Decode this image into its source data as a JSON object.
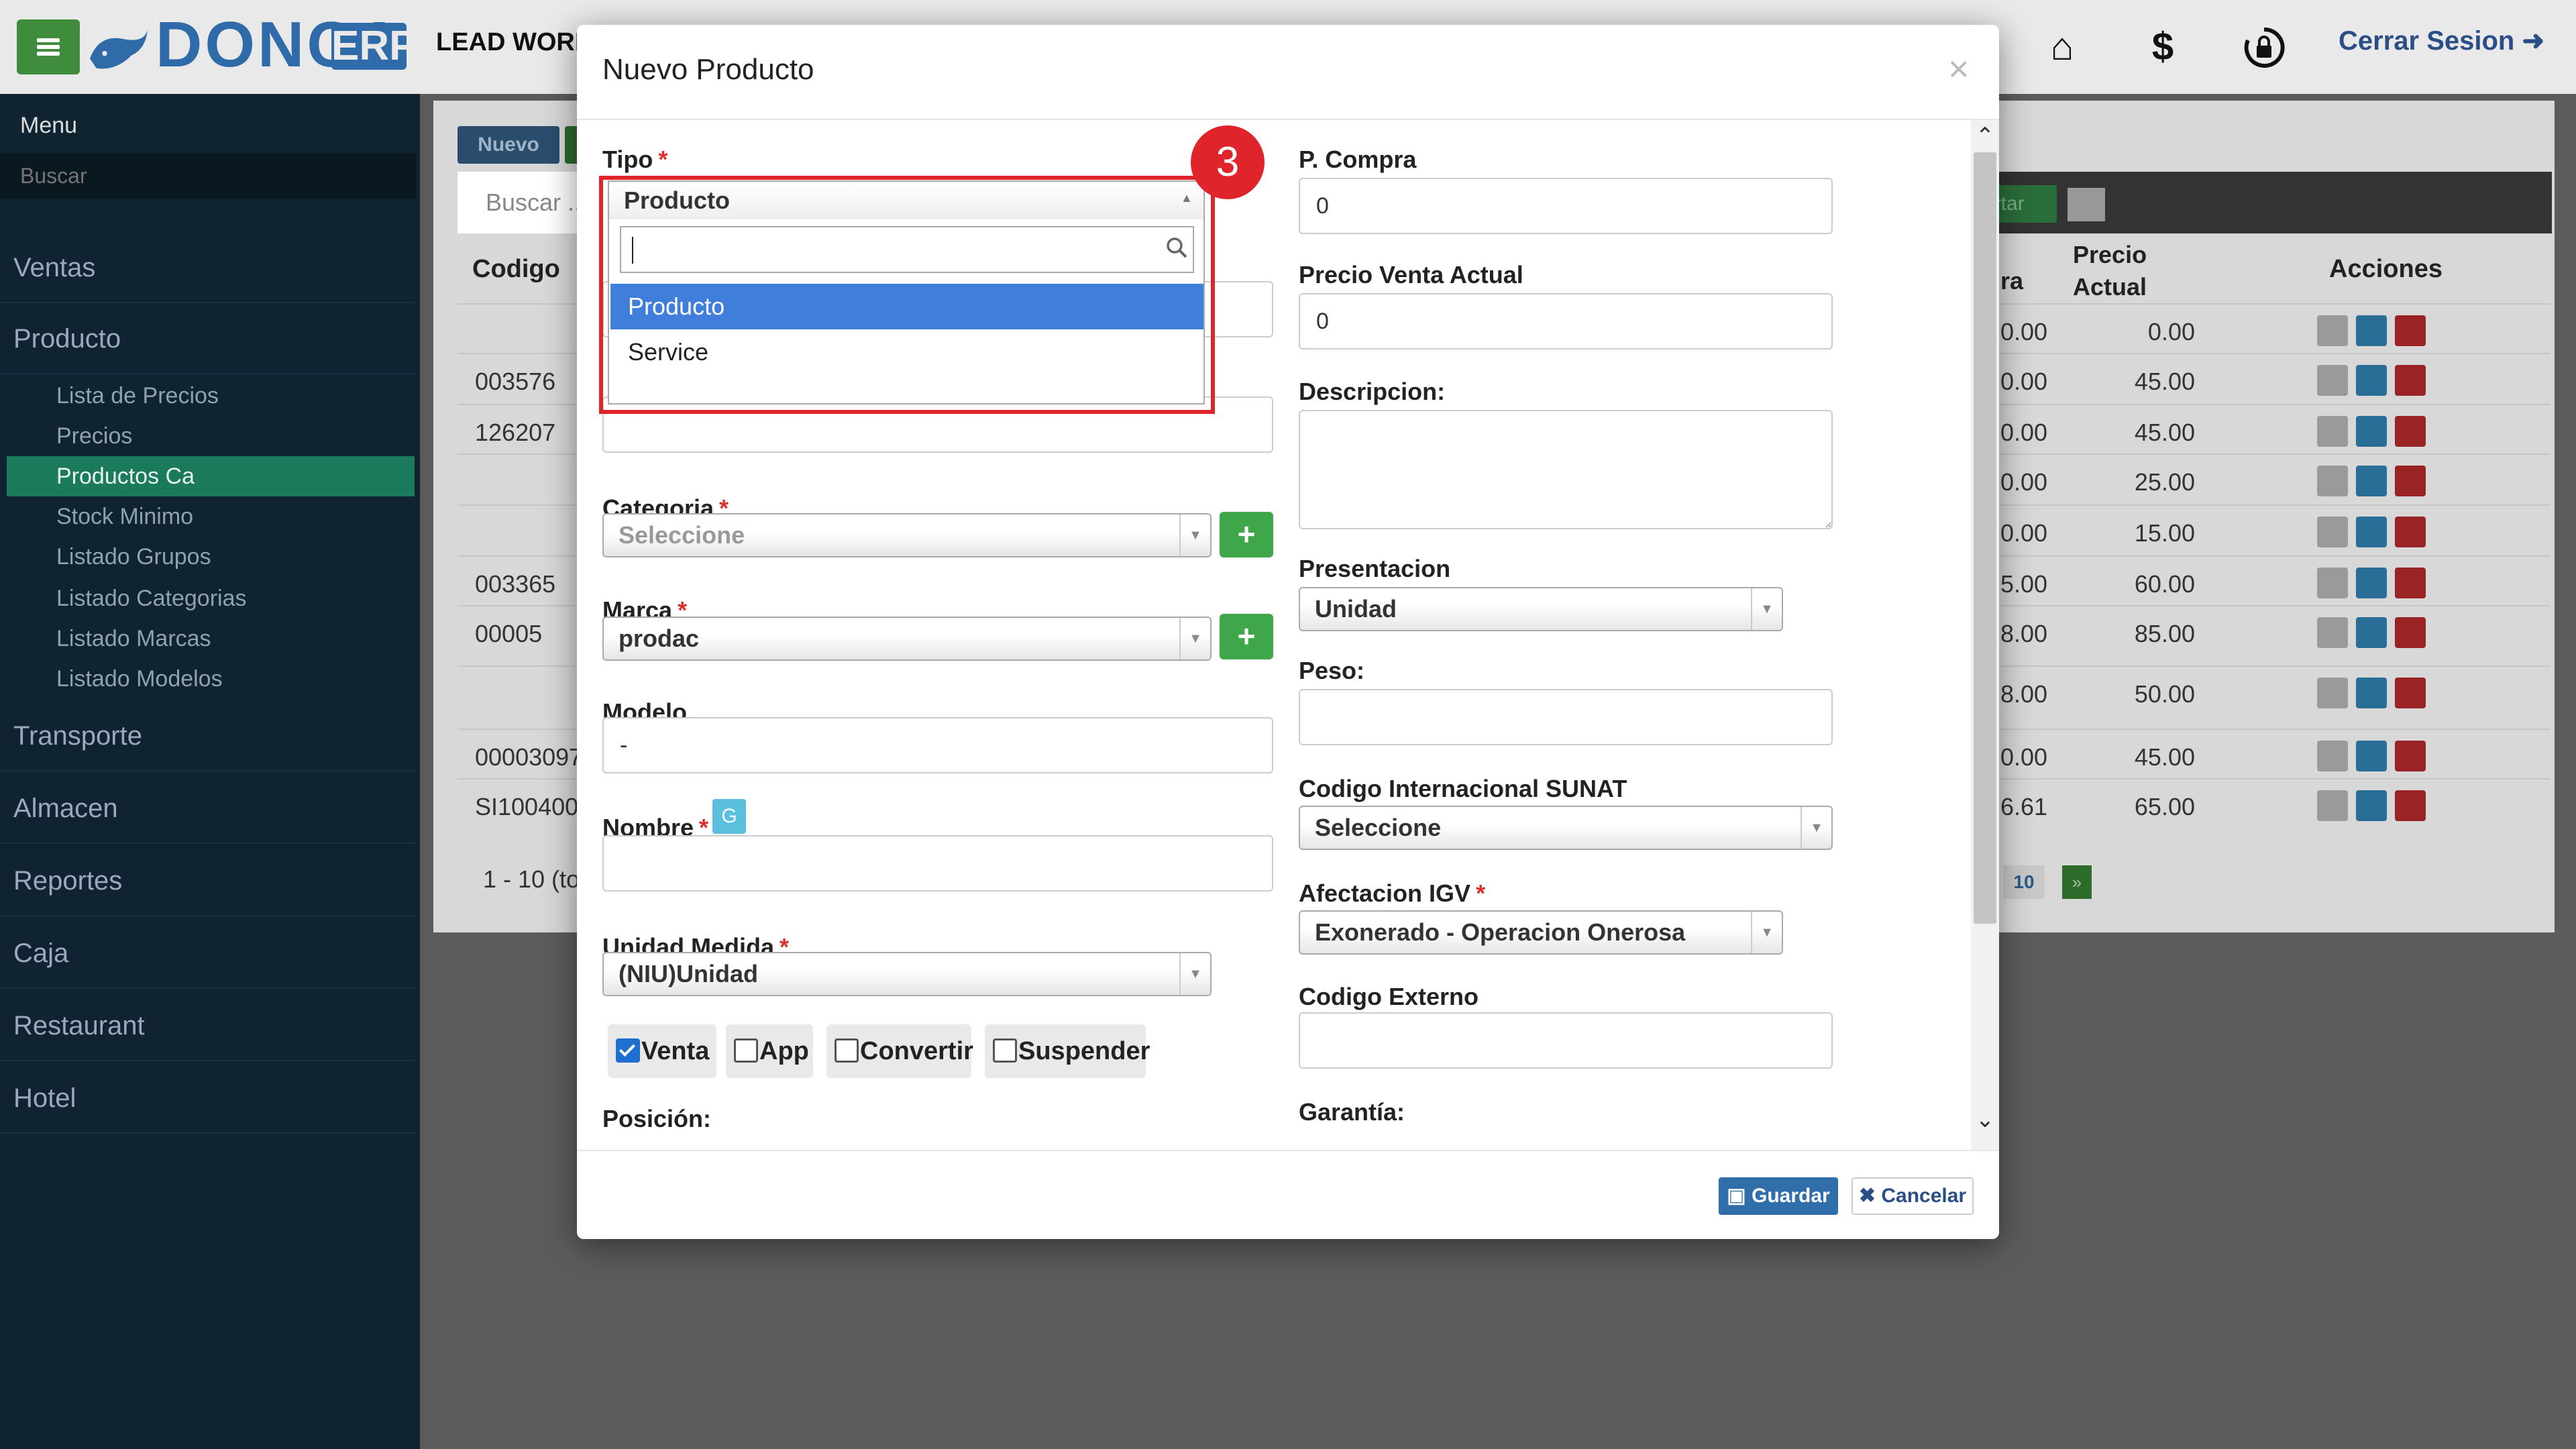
{
  "header": {
    "logo_text": "DONCA",
    "logo_badge": "ERP",
    "lead_text": "LEAD WORK",
    "logout_label": "Cerrar Sesion"
  },
  "sidebar": {
    "title": "Menu",
    "search_placeholder": "Buscar",
    "items": [
      {
        "label": "Ventas"
      },
      {
        "label": "Producto"
      },
      {
        "label": "Transporte"
      },
      {
        "label": "Almacen"
      },
      {
        "label": "Reportes"
      },
      {
        "label": "Caja"
      },
      {
        "label": "Restaurant"
      },
      {
        "label": "Hotel"
      }
    ],
    "subitems": [
      {
        "label": "Lista de Precios"
      },
      {
        "label": "Precios"
      },
      {
        "label": "Productos Ca"
      },
      {
        "label": "Stock Minimo"
      },
      {
        "label": "Listado Grupos"
      },
      {
        "label": "Listado Categorias"
      },
      {
        "label": "Listado Marcas"
      },
      {
        "label": "Listado Modelos"
      }
    ]
  },
  "background": {
    "nuevo_label": "Nuevo",
    "search_placeholder": "Buscar ...",
    "exportar_label": "ortar",
    "headers": {
      "codigo": "Codigo",
      "prev": "ra",
      "precio": "Precio Actual",
      "acciones": "Acciones"
    },
    "rows": [
      {
        "codigo": "",
        "prev": "0.00",
        "precio": "0.00"
      },
      {
        "codigo": "003576",
        "prev": "0.00",
        "precio": "45.00"
      },
      {
        "codigo": "126207",
        "prev": "0.00",
        "precio": "45.00"
      },
      {
        "codigo": "",
        "prev": "0.00",
        "precio": "25.00"
      },
      {
        "codigo": "",
        "prev": "0.00",
        "precio": "15.00"
      },
      {
        "codigo": "003365",
        "prev": "5.00",
        "precio": "60.00"
      },
      {
        "codigo": "00005",
        "prev": "8.00",
        "precio": "85.00"
      },
      {
        "codigo": "",
        "prev": "8.00",
        "precio": "50.00"
      },
      {
        "codigo": "00003097",
        "prev": "0.00",
        "precio": "45.00"
      },
      {
        "codigo": "SI100400",
        "prev": "6.61",
        "precio": "65.00"
      }
    ],
    "pagination_text": "1 - 10 (to",
    "page_number": "10",
    "page_next": "»"
  },
  "modal": {
    "title": "Nuevo Producto",
    "close": "×",
    "tipo": {
      "label": "Tipo",
      "value": "Producto",
      "search_value": "",
      "options": [
        "Producto",
        "Service"
      ],
      "highlighted": "Producto"
    },
    "step_badge": "3",
    "categoria": {
      "label": "Categoria",
      "value": "Seleccione"
    },
    "marca": {
      "label": "Marca",
      "value": "prodac"
    },
    "modelo": {
      "label": "Modelo",
      "value": "-"
    },
    "nombre": {
      "label": "Nombre",
      "badge": "G",
      "value": ""
    },
    "unidad_medida": {
      "label": "Unidad Medida",
      "value": "(NIU)Unidad"
    },
    "checkboxes": [
      {
        "label": "Venta",
        "checked": true
      },
      {
        "label": "App",
        "checked": false
      },
      {
        "label": "Convertir",
        "checked": false
      },
      {
        "label": "Suspender",
        "checked": false
      }
    ],
    "posicion_label": "Posición:",
    "p_compra": {
      "label": "P. Compra",
      "value": "0"
    },
    "precio_venta": {
      "label": "Precio Venta Actual",
      "value": "0"
    },
    "descripcion": {
      "label": "Descripcion:",
      "value": ""
    },
    "presentacion": {
      "label": "Presentacion",
      "value": "Unidad"
    },
    "peso": {
      "label": "Peso:",
      "value": ""
    },
    "codigo_sunat": {
      "label": "Codigo Internacional SUNAT",
      "value": "Seleccione"
    },
    "afectacion_igv": {
      "label": "Afectacion IGV",
      "value": "Exonerado - Operacion Onerosa"
    },
    "codigo_externo": {
      "label": "Codigo Externo",
      "value": ""
    },
    "garantia_label": "Garantía:",
    "required_mark": "*",
    "guardar_label": "Guardar",
    "cancelar_label": "Cancelar"
  },
  "colors": {
    "highlight": "#e0242c",
    "selected_option": "#3f7edb",
    "sidebar_active": "#1b7a5b",
    "primary": "#2f6ea8"
  }
}
